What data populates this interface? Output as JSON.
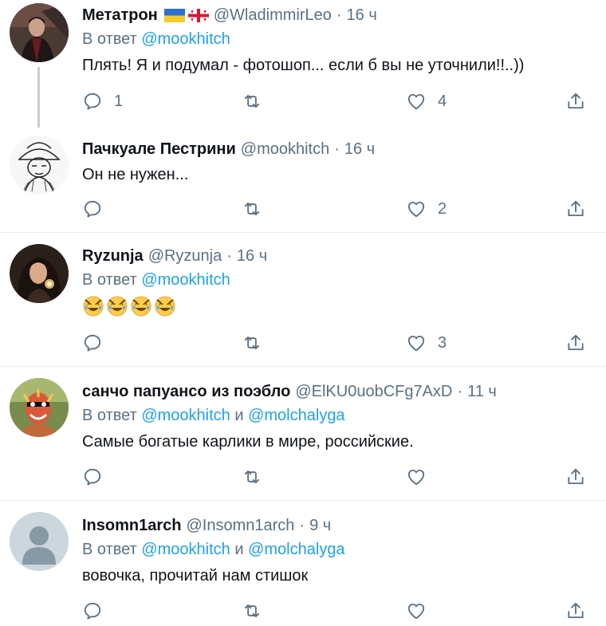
{
  "tweets": [
    {
      "name": "Метатрон",
      "handle": "@WladimmirLeo",
      "sep": "·",
      "time": "16 ч",
      "reply_prefix": "В ответ",
      "mention1": "@mookhitch",
      "text": "Плять! Я и подумал - фотошоп... если б вы не уточнили!!..))",
      "reply_count": "1",
      "like_count": "4"
    },
    {
      "name": "Пачкуале Пестрини",
      "handle": "@mookhitch",
      "sep": "·",
      "time": "16 ч",
      "text": "Он не нужен...",
      "reply_count": "",
      "like_count": "2"
    },
    {
      "name": "Ryzunja",
      "handle": "@Ryzunja",
      "sep": "·",
      "time": "16 ч",
      "reply_prefix": "В ответ",
      "mention1": "@mookhitch",
      "emoji_count": 4,
      "reply_count": "",
      "like_count": "3"
    },
    {
      "name": "санчо папуансо из поэбло",
      "handle": "@ElKU0uobCFg7AxD",
      "sep": "·",
      "time": "11 ч",
      "reply_prefix": "В ответ",
      "mention1": "@mookhitch",
      "conj": "и",
      "mention2": "@molchalyga",
      "text": "Самые богатые карлики в мире, российские.",
      "reply_count": "",
      "like_count": ""
    },
    {
      "name": "Insomn1arch",
      "handle": "@Insomn1arch",
      "sep": "·",
      "time": "9 ч",
      "reply_prefix": "В ответ",
      "mention1": "@mookhitch",
      "conj": "и",
      "mention2": "@molchalyga",
      "text": "вовочка, прочитай нам стишок",
      "reply_count": "",
      "like_count": ""
    }
  ],
  "icons": {
    "reply": "reply-icon",
    "retweet": "retweet-icon",
    "like": "heart-icon",
    "share": "share-icon"
  },
  "colors": {
    "link": "#1da1f2",
    "muted": "#5b7083",
    "divider": "#e6ecf0"
  }
}
